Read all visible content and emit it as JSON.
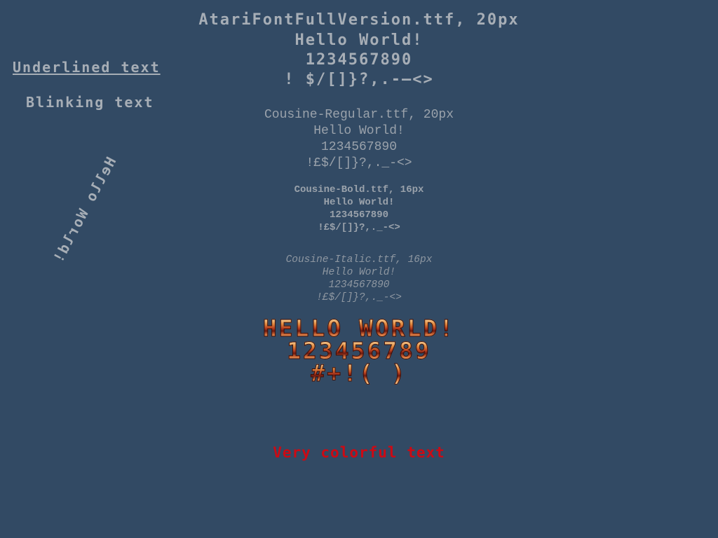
{
  "atari_block": {
    "title": "AtariFontFullVersion.ttf, 20px",
    "hello": "Hello World!",
    "digits": "1234567890",
    "symbols": "! $/[]}?,.-–<>"
  },
  "left_labels": {
    "underlined": "Underlined text",
    "blinking": "Blinking text",
    "rotated": "Hello World!"
  },
  "cousine_regular": {
    "title": "Cousine-Regular.ttf, 20px",
    "hello": "Hello World!",
    "digits": "1234567890",
    "symbols": "!£$/[]}?,._-<>"
  },
  "cousine_bold": {
    "title": "Cousine-Bold.ttf, 16px",
    "hello": "Hello World!",
    "digits": "1234567890",
    "symbols": "!£$/[]}?,._-<>"
  },
  "cousine_italic": {
    "title": "Cousine-Italic.ttf, 16px",
    "hello": "Hello World!",
    "digits": "1234567890",
    "symbols": "!£$/[]}?,._-<>"
  },
  "bitmap_block": {
    "hello": "HELLO WORLD!",
    "digits": "123456789",
    "symbols": "#+!( )"
  },
  "colorful": {
    "text": "Very colorful text",
    "color": "#cc0a14"
  },
  "colors": {
    "background": "#324a64",
    "text_gray": "#a7aeb6"
  }
}
